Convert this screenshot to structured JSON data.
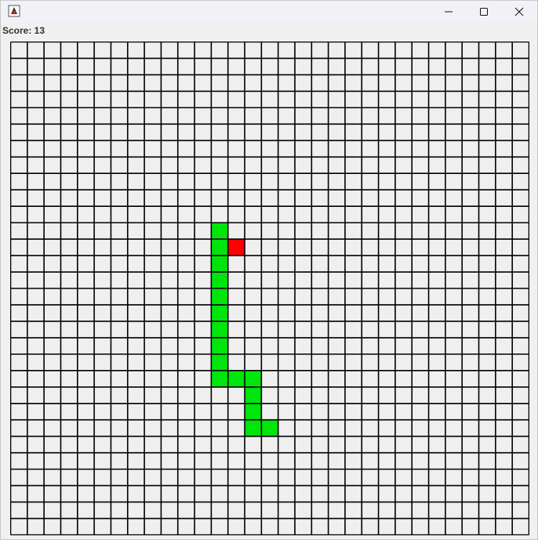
{
  "window": {
    "title": "",
    "icon": "java-duke-icon",
    "buttons": [
      "minimize-icon",
      "maximize-icon",
      "close-icon"
    ]
  },
  "score": {
    "text": "Score: 13"
  },
  "board": {
    "columns": 31,
    "rows": 30,
    "colors": {
      "empty": "#efefef",
      "grid_line": "#000000",
      "snake": "#00e60c",
      "food": "#ff0000"
    },
    "snake": [
      [
        12,
        11
      ],
      [
        12,
        12
      ],
      [
        12,
        13
      ],
      [
        12,
        14
      ],
      [
        12,
        15
      ],
      [
        12,
        16
      ],
      [
        12,
        17
      ],
      [
        12,
        18
      ],
      [
        12,
        19
      ],
      [
        12,
        20
      ],
      [
        13,
        20
      ],
      [
        14,
        20
      ],
      [
        14,
        21
      ],
      [
        14,
        22
      ],
      [
        14,
        23
      ],
      [
        15,
        23
      ]
    ],
    "food": [
      [
        13,
        12
      ]
    ]
  }
}
